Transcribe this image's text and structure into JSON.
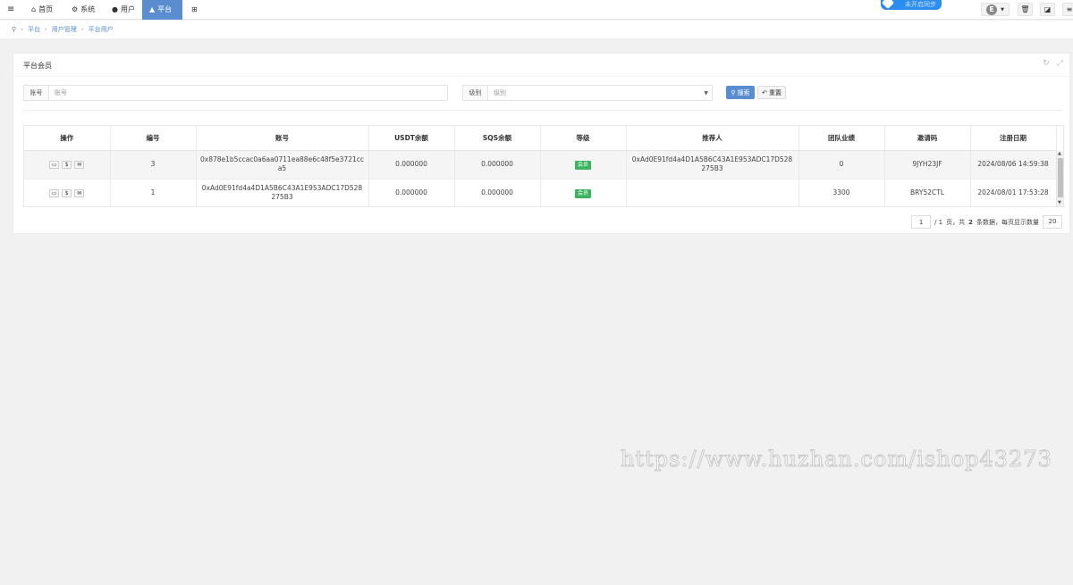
{
  "nav": {
    "menu_icon": "hamburger-icon",
    "items": [
      {
        "label": "首页",
        "icon": "home-icon"
      },
      {
        "label": "系统",
        "icon": "gear-icon"
      },
      {
        "label": "用户",
        "icon": "user-icon"
      },
      {
        "label": "平台",
        "icon": "bag-icon",
        "active": true
      }
    ],
    "grid_icon": "grid-icon",
    "sync_label": "未开启同步",
    "avatar_letter": "E",
    "accent": "#5a8dd0"
  },
  "breadcrumb": {
    "icon": "location-pin-icon",
    "items": [
      "平台",
      "用户管理",
      "平台用户"
    ]
  },
  "panel": {
    "title": "平台会员"
  },
  "filters": {
    "account_label": "账号",
    "account_placeholder": "账号",
    "level_label": "级别",
    "level_placeholder": "级别",
    "search_label": "搜索",
    "reset_label": "重置"
  },
  "table": {
    "columns": [
      "操作",
      "编号",
      "账号",
      "USDT余额",
      "SQS余额",
      "等级",
      "推荐人",
      "团队业绩",
      "邀请码",
      "注册日期"
    ],
    "rows": [
      {
        "id": "3",
        "account": "0x878e1b5ccac0a6aa0711ea88e6c48f5e3721cca5",
        "usdt": "0.000000",
        "sqs": "0.000000",
        "level": "会员",
        "referrer": "0xAd0E91fd4a4D1A5B6C43A1E953ADC17D528275B3",
        "team": "0",
        "invite": "9JYH23JF",
        "date": "2024/08/06 14:59:38"
      },
      {
        "id": "1",
        "account": "0xAd0E91fd4a4D1A5B6C43A1E953ADC17D528275B3",
        "usdt": "0.000000",
        "sqs": "0.000000",
        "level": "会员",
        "referrer": "",
        "team": "3300",
        "invite": "BRY52CTL",
        "date": "2024/08/01 17:53:28"
      }
    ],
    "level_color": "#3ab55d"
  },
  "pager": {
    "current": "1",
    "total_pages": "/ 1",
    "text_mid": "页，共",
    "total_rows": "2",
    "text_end": "条数据，每页显示数量",
    "page_size": "20"
  },
  "watermark": "https://www.huzhan.com/ishop43273"
}
